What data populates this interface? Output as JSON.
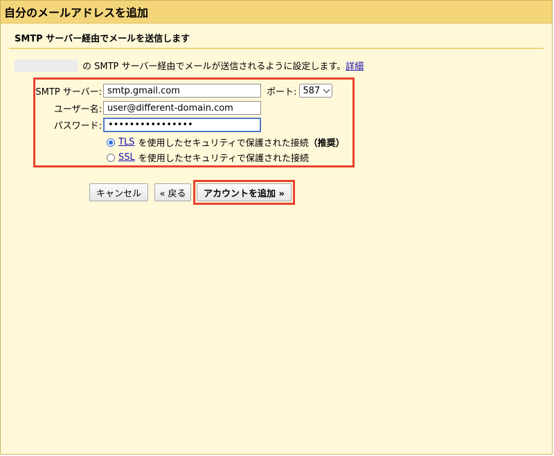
{
  "window": {
    "title": "自分のメールアドレスを追加"
  },
  "section": {
    "heading": "SMTP サーバー経由でメールを送信します",
    "description": "の SMTP サーバー経由でメールが送信されるように設定します。",
    "details_link": "詳細"
  },
  "form": {
    "smtp_server_label": "SMTP サーバー:",
    "smtp_server_value": "smtp.gmail.com",
    "port_label": "ポート:",
    "port_value": "587",
    "username_label": "ユーザー名:",
    "username_value": "user@different-domain.com",
    "password_label": "パスワード:",
    "password_value": "••••••••••••••••",
    "tls_link": "TLS",
    "tls_text": "を使用したセキュリティで保護された接続",
    "tls_recommended": "（推奨）",
    "ssl_link": "SSL",
    "ssl_text": "を使用したセキュリティで保護された接続",
    "selected_security": "TLS"
  },
  "buttons": {
    "cancel": "キャンセル",
    "back": "« 戻る",
    "add_account": "アカウントを追加 »"
  },
  "colors": {
    "titlebar": "#f4d57a",
    "background": "#fff8d9",
    "highlight_border": "#e8412c",
    "link": "#1a0dab"
  }
}
